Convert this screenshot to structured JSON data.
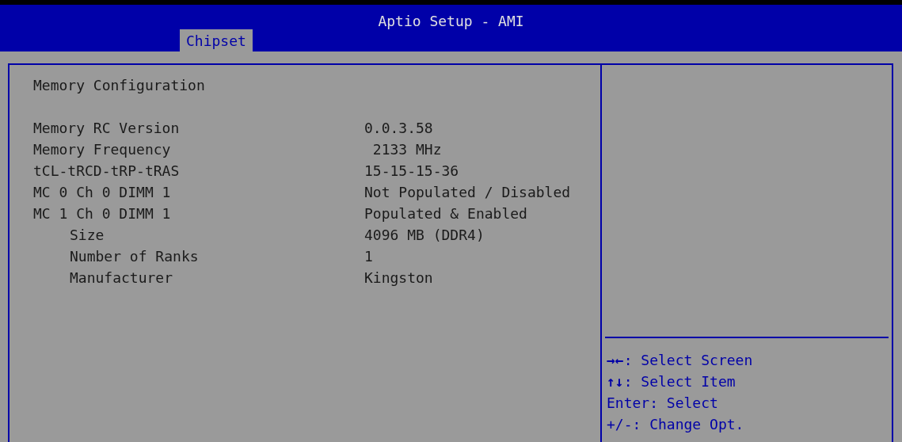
{
  "window": {
    "title": "Aptio Setup - AMI"
  },
  "tabs": [
    {
      "label": "Chipset",
      "selected": true
    }
  ],
  "section_title": "Memory Configuration",
  "rows": [
    {
      "label": "Memory RC Version",
      "value": "0.0.3.58"
    },
    {
      "label": "Memory Frequency",
      "value": " 2133 MHz"
    },
    {
      "label": "tCL-tRCD-tRP-tRAS",
      "value": "15-15-15-36"
    },
    {
      "label": "MC 0 Ch 0 DIMM 1",
      "value": "Not Populated / Disabled"
    },
    {
      "label": "MC 1 Ch 0 DIMM 1",
      "value": "Populated & Enabled",
      "children": [
        {
          "label": "Size",
          "value": "4096 MB (DDR4)"
        },
        {
          "label": "Number of Ranks",
          "value": "1"
        },
        {
          "label": "Manufacturer",
          "value": "Kingston"
        }
      ]
    }
  ],
  "help_keys": [
    "**→←**: Select Screen",
    "**↑↓**: Select Item",
    "Enter: Select",
    "+/-: Change Opt."
  ]
}
